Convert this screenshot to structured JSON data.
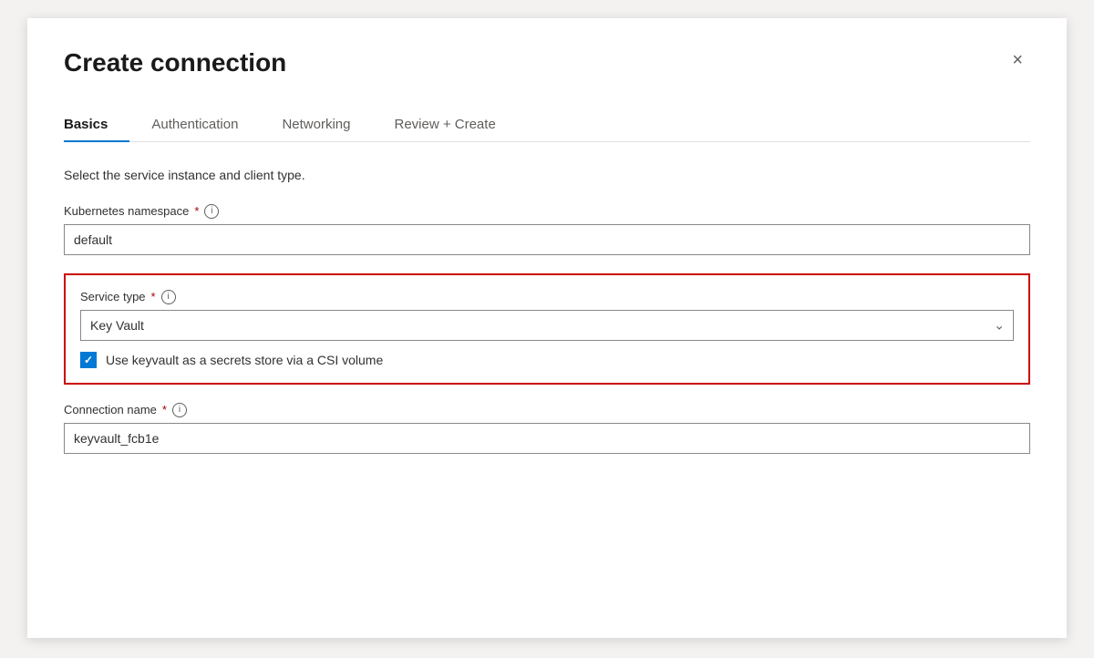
{
  "dialog": {
    "title": "Create connection",
    "close_label": "×"
  },
  "tabs": [
    {
      "id": "basics",
      "label": "Basics",
      "active": true
    },
    {
      "id": "authentication",
      "label": "Authentication",
      "active": false
    },
    {
      "id": "networking",
      "label": "Networking",
      "active": false
    },
    {
      "id": "review-create",
      "label": "Review + Create",
      "active": false
    }
  ],
  "form": {
    "description": "Select the service instance and client type.",
    "kubernetes_namespace": {
      "label": "Kubernetes namespace",
      "required": "*",
      "info": "i",
      "value": "default"
    },
    "service_type": {
      "label": "Service type",
      "required": "*",
      "info": "i",
      "value": "Key Vault",
      "options": [
        "Key Vault"
      ]
    },
    "checkbox": {
      "label": "Use keyvault as a secrets store via a CSI volume",
      "checked": true,
      "check_symbol": "✓"
    },
    "connection_name": {
      "label": "Connection name",
      "required": "*",
      "info": "i",
      "value": "keyvault_fcb1e"
    }
  }
}
